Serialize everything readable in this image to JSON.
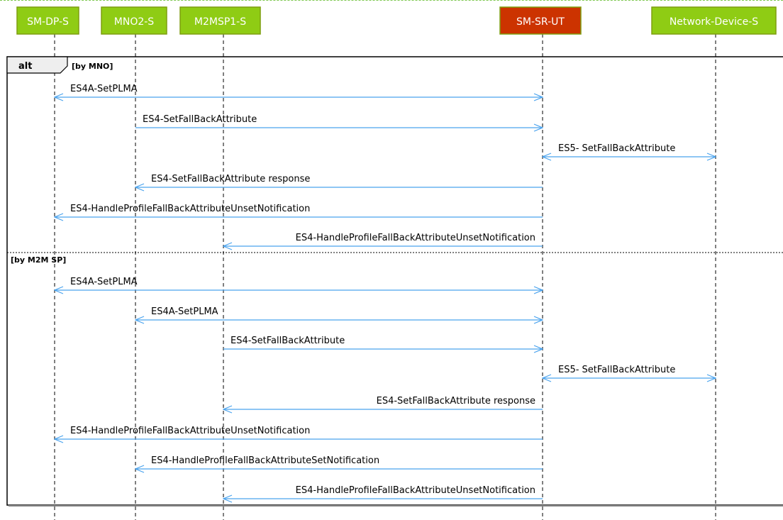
{
  "participants": [
    {
      "name": "SM-DP-S",
      "color": "#8fcc14"
    },
    {
      "name": "MNO2-S",
      "color": "#8fcc14"
    },
    {
      "name": "M2MSP1-S",
      "color": "#8fcc14"
    },
    {
      "name": "SM-SR-UT",
      "color": "#cc3300"
    },
    {
      "name": "Network-Device-S",
      "color": "#8fcc14"
    }
  ],
  "colors": {
    "arrow": "#4aa3ee",
    "lifeline": "#000000",
    "frame": "#000000",
    "participant_border": "#7e9e10",
    "participant_text": "#ffffff"
  },
  "alt": {
    "keyword": "alt",
    "sections": [
      {
        "guard": "[by MNO]",
        "messages": [
          {
            "from": 0,
            "to": 3,
            "label": "ES4A-SetPLMA",
            "bidirectional": true
          },
          {
            "from": 1,
            "to": 3,
            "label": "ES4-SetFallBackAttribute",
            "bidirectional": false
          },
          {
            "from": 3,
            "to": 4,
            "label": "ES5- SetFallBackAttribute",
            "bidirectional": true
          },
          {
            "from": 3,
            "to": 1,
            "label": "ES4-SetFallBackAttribute response",
            "bidirectional": false
          },
          {
            "from": 3,
            "to": 0,
            "label": "ES4-HandleProfileFallBackAttributeUnsetNotification",
            "bidirectional": false
          },
          {
            "from": 3,
            "to": 2,
            "label": "ES4-HandleProfileFallBackAttributeUnsetNotification",
            "bidirectional": false
          }
        ]
      },
      {
        "guard": "[by M2M SP]",
        "messages": [
          {
            "from": 0,
            "to": 3,
            "label": "ES4A-SetPLMA",
            "bidirectional": true
          },
          {
            "from": 1,
            "to": 3,
            "label": "ES4A-SetPLMA",
            "bidirectional": true
          },
          {
            "from": 2,
            "to": 3,
            "label": "ES4-SetFallBackAttribute",
            "bidirectional": false
          },
          {
            "from": 3,
            "to": 4,
            "label": "ES5- SetFallBackAttribute",
            "bidirectional": true
          },
          {
            "from": 3,
            "to": 2,
            "label": "ES4-SetFallBackAttribute response",
            "bidirectional": false
          },
          {
            "from": 3,
            "to": 0,
            "label": "ES4-HandleProfileFallBackAttributeUnsetNotification",
            "bidirectional": false
          },
          {
            "from": 3,
            "to": 1,
            "label": "ES4-HandleProfileFallBackAttributeSetNotification",
            "bidirectional": false
          },
          {
            "from": 3,
            "to": 2,
            "label": "ES4-HandleProfileFallBackAttributeUnsetNotification",
            "bidirectional": false
          }
        ]
      }
    ]
  }
}
